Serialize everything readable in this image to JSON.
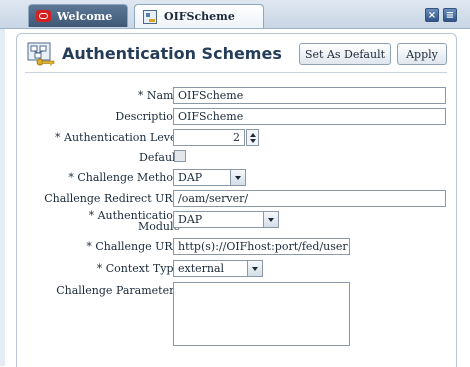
{
  "tabs": [
    {
      "label": "Welcome",
      "icon": "oracle-icon"
    },
    {
      "label": "OIFScheme",
      "icon": "authentication-scheme-icon"
    }
  ],
  "window_buttons": [
    {
      "name": "close-tab",
      "glyph": "×"
    },
    {
      "name": "tab-menu",
      "glyph": "≡"
    }
  ],
  "page": {
    "title": "Authentication Schemes",
    "icon": "authentication-scheme-key-icon"
  },
  "toolbar": {
    "set_default_label": "Set As Default",
    "apply_label": "Apply"
  },
  "form": {
    "name": {
      "label": "Name",
      "required": "*",
      "value": "OIFScheme"
    },
    "description": {
      "label": "Description",
      "value": "OIFScheme"
    },
    "auth_level": {
      "label": "Authentication Level",
      "required": "*",
      "value": "2"
    },
    "default": {
      "label": "Default",
      "checked": false
    },
    "challenge_method": {
      "label": "Challenge Method",
      "required": "*",
      "value": "DAP"
    },
    "challenge_redirect_url": {
      "label": "Challenge Redirect URL",
      "value": "/oam/server/"
    },
    "auth_module": {
      "label_line1": "Authentication",
      "label_line2": "Module",
      "required": "*",
      "value": "DAP"
    },
    "challenge_url": {
      "label": "Challenge URL",
      "required": "*",
      "value": "http(s)://OIFhost:port/fed/user"
    },
    "context_type": {
      "label": "Context Type",
      "required": "*",
      "value": "external"
    },
    "challenge_parameters": {
      "label": "Challenge Parameters",
      "value": ""
    }
  },
  "colors": {
    "tab_active_bg": "#ffffff",
    "tab_inactive_bg": "#4d6886",
    "title_color": "#263d5a",
    "oracle_red": "#d42020"
  }
}
